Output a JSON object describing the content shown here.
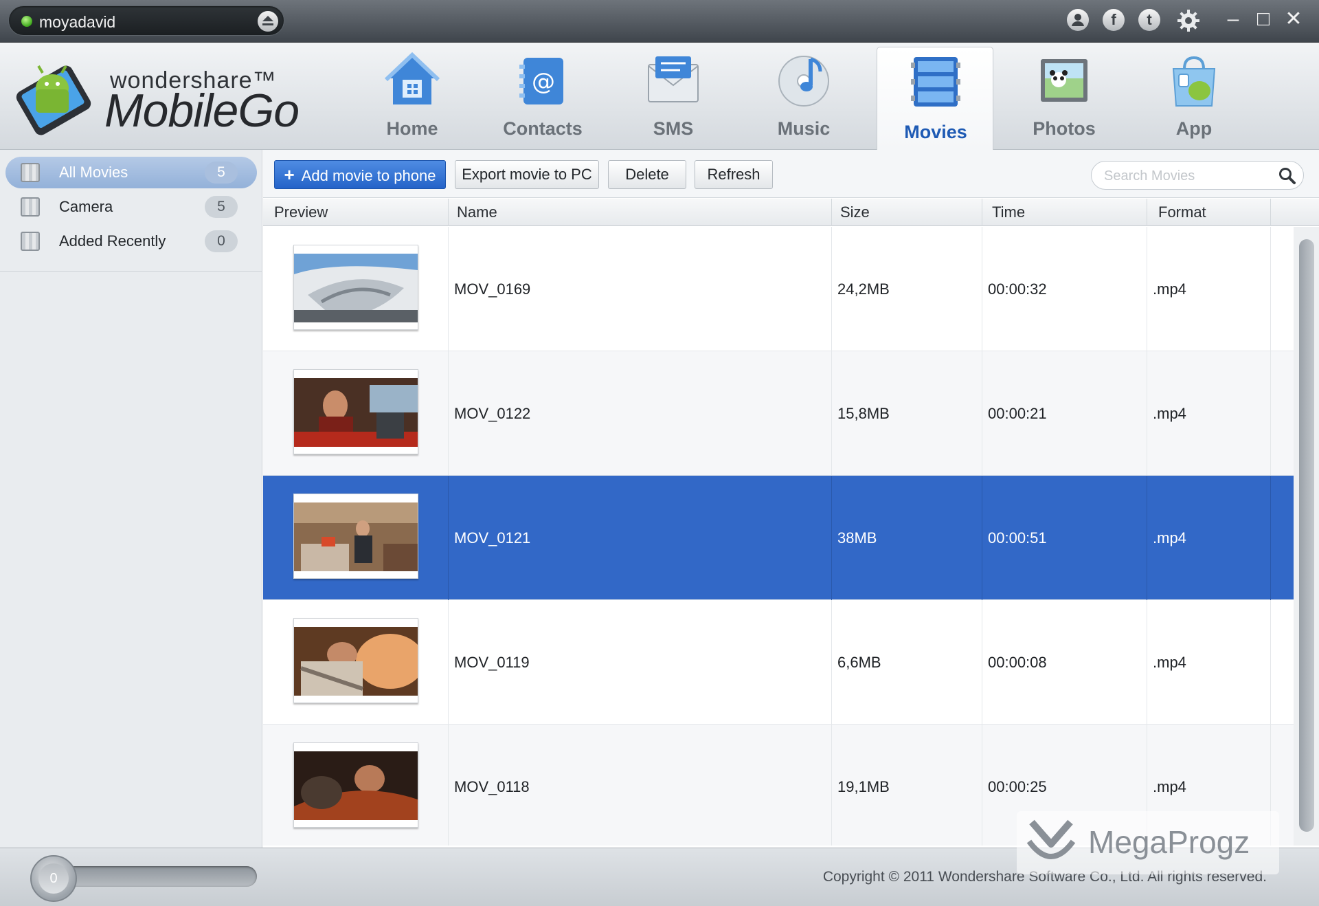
{
  "titlebar": {
    "device_name": "moyadavid",
    "status_color": "#3ea81c"
  },
  "brand": {
    "line1": "wondershare™",
    "line2": "MobileGo"
  },
  "nav": {
    "items": [
      {
        "label": "Home",
        "icon": "house-icon"
      },
      {
        "label": "Contacts",
        "icon": "contacts-icon"
      },
      {
        "label": "SMS",
        "icon": "envelope-icon"
      },
      {
        "label": "Music",
        "icon": "music-disc-icon"
      },
      {
        "label": "Movies",
        "icon": "film-icon",
        "active": true
      },
      {
        "label": "Photos",
        "icon": "photo-icon"
      },
      {
        "label": "App",
        "icon": "app-bag-icon"
      }
    ]
  },
  "sidebar": {
    "items": [
      {
        "label": "All Movies",
        "count": "5",
        "selected": true
      },
      {
        "label": "Camera",
        "count": "5"
      },
      {
        "label": "Added Recently",
        "count": "0"
      }
    ]
  },
  "toolbar": {
    "add_label": "Add movie to phone",
    "export_label": "Export movie to PC",
    "delete_label": "Delete",
    "refresh_label": "Refresh",
    "search_placeholder": "Search Movies"
  },
  "table": {
    "columns": [
      "Preview",
      "Name",
      "Size",
      "Time",
      "Format"
    ],
    "rows": [
      {
        "name": "MOV_0169",
        "size": "24,2MB",
        "time": "00:00:32",
        "format": ".mp4"
      },
      {
        "name": "MOV_0122",
        "size": "15,8MB",
        "time": "00:00:21",
        "format": ".mp4"
      },
      {
        "name": "MOV_0121",
        "size": "38MB",
        "time": "00:00:51",
        "format": ".mp4",
        "selected": true
      },
      {
        "name": "MOV_0119",
        "size": "6,6MB",
        "time": "00:00:08",
        "format": ".mp4"
      },
      {
        "name": "MOV_0118",
        "size": "19,1MB",
        "time": "00:00:25",
        "format": ".mp4"
      }
    ]
  },
  "footer": {
    "progress_value": "0",
    "copyright": "Copyright © 2011 Wondershare Software Co., Ltd. All rights reserved."
  },
  "watermark": {
    "text": "MegaProgz"
  },
  "colors": {
    "accent": "#3268c7",
    "nav_active": "#1e5ab4"
  }
}
